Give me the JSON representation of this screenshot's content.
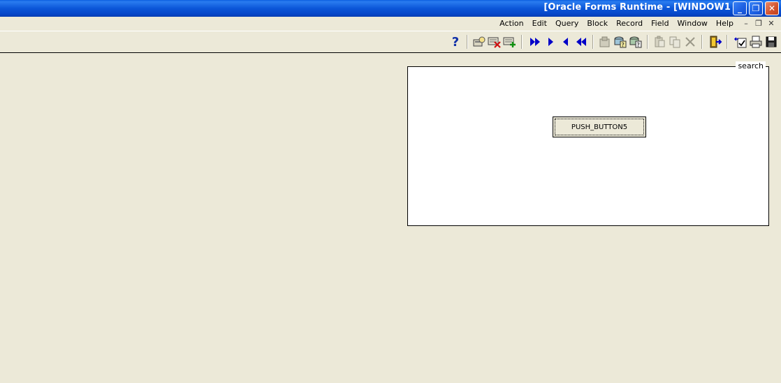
{
  "window": {
    "title": "[Oracle Forms Runtime - [WINDOW1",
    "minimize_glyph": "_",
    "restore_glyph": "❐",
    "close_glyph": "✕"
  },
  "menubar": {
    "items": [
      "Help",
      "Window",
      "Field",
      "Record",
      "Block",
      "Query",
      "Edit",
      "Action"
    ],
    "mdi_minimize": "–",
    "mdi_restore": "❐",
    "mdi_close": "✕"
  },
  "toolbar": {
    "icons": [
      "help-icon",
      "enter-query-icon",
      "remove-record-icon",
      "insert-record-icon",
      "next-block-icon",
      "next-record-icon",
      "previous-record-icon",
      "previous-block-icon",
      "clear-record-icon",
      "execute-query-icon",
      "count-query-icon",
      "paste-icon",
      "copy-icon",
      "cut-icon",
      "exit-icon",
      "commit-icon",
      "print-icon",
      "save-icon"
    ],
    "help_glyph": "?"
  },
  "canvas": {
    "frame_title": "search",
    "push_button_label": "PUSH_BUTTON5"
  },
  "colors": {
    "titlebar": "#0b56d8",
    "background": "#ece9d8",
    "nav_arrow": "#0000c8"
  }
}
